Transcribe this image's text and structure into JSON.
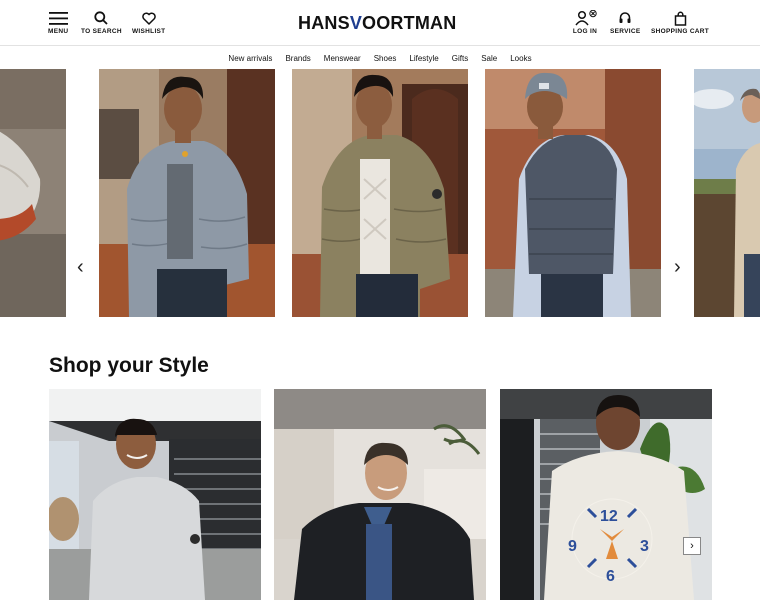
{
  "header": {
    "menu_label": "MENU",
    "search_label": "TO SEARCH",
    "wishlist_label": "WISHLIST",
    "logo_part1": "HANS",
    "logo_v": "V",
    "logo_part2": "OORTMAN",
    "login_label": "LOG IN",
    "service_label": "SERVICE",
    "cart_label": "SHOPPING CART"
  },
  "nav": {
    "items": [
      "New arrivals",
      "Brands",
      "Menswear",
      "Shoes",
      "Lifestyle",
      "Gifts",
      "Sale",
      "Looks"
    ]
  },
  "carousel": {
    "prev_arrow": "‹",
    "next_arrow": "›"
  },
  "shop_style": {
    "title": "Shop your Style",
    "next_button": "›"
  }
}
